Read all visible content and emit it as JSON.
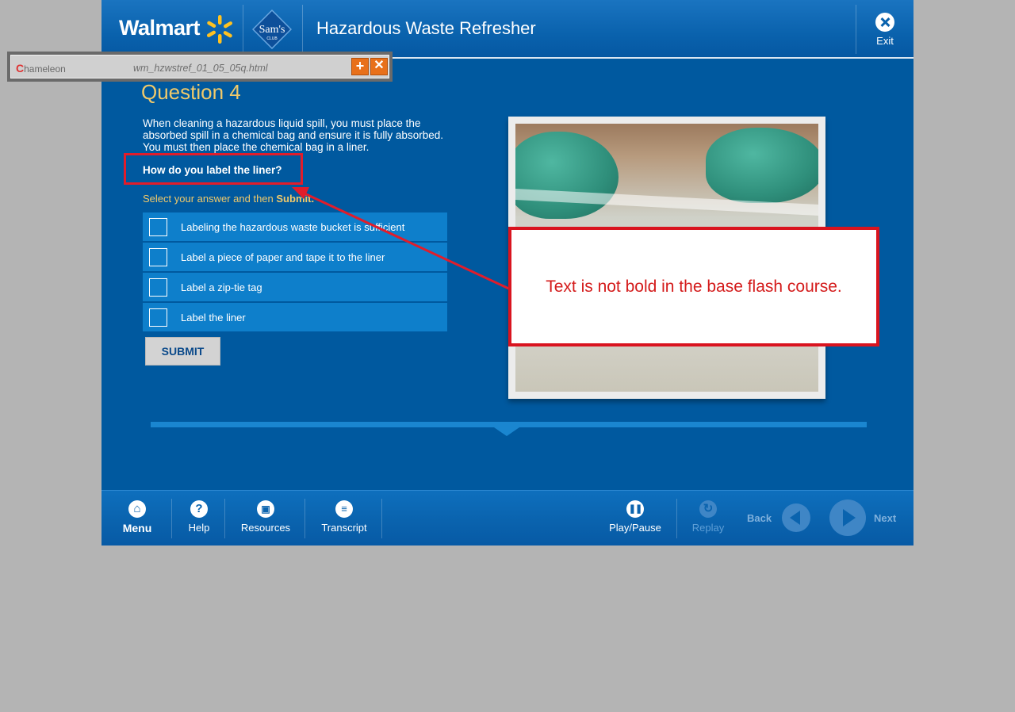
{
  "header": {
    "walmart_logo": "Walmart",
    "sams_logo": "Sam's",
    "sams_sub": "CLUB",
    "course_title": "Hazardous Waste Refresher",
    "exit_label": "Exit"
  },
  "chameleon": {
    "logo": "hameleon",
    "file": "wm_hzwstref_01_05_05q.html"
  },
  "question": {
    "title": "Question 4",
    "stem": "When cleaning a hazardous liquid spill, you must place the absorbed spill in a chemical bag and ensure it is fully absorbed.  You must then place the chemical bag in a liner.",
    "prompt": "How do you label the liner?",
    "instruction_prefix": "Select your answer and then ",
    "instruction_bold": "Submit.",
    "options": [
      "Labeling the hazardous waste bucket is sufficient",
      "Label a piece of paper and tape it to the liner",
      "Label a zip-tie tag",
      "Label the liner"
    ],
    "submit_label": "SUBMIT"
  },
  "annotation": {
    "callout_text": "Text is not bold in the base flash course."
  },
  "footer": {
    "menu": "Menu",
    "help": "Help",
    "resources": "Resources",
    "transcript": "Transcript",
    "play_pause": "Play/Pause",
    "replay": "Replay",
    "back": "Back",
    "next": "Next"
  },
  "colors": {
    "background": "#00599f",
    "accent_gold": "#f0c96a",
    "option_bg": "#0e7fcb",
    "annotation_red": "#d9141f"
  }
}
